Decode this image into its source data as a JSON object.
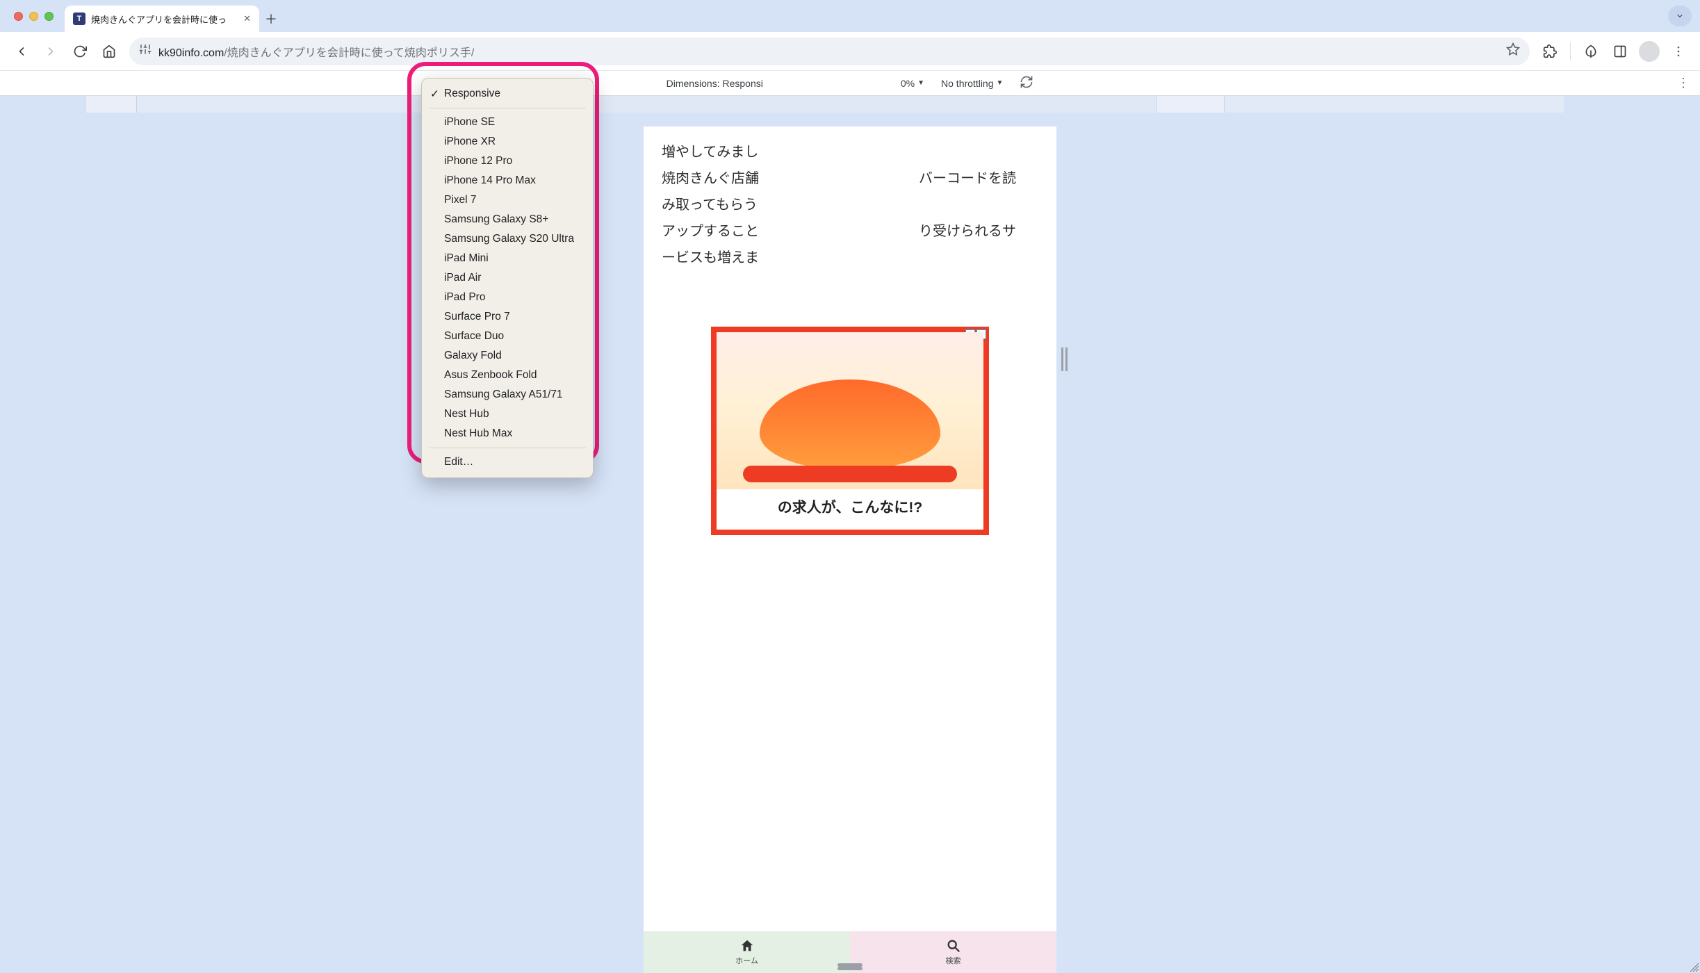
{
  "browser": {
    "tab_title": "焼肉きんぐアプリを会計時に使っ",
    "url_domain": "kk90info.com",
    "url_path": "/焼肉きんぐアプリを会計時に使って焼肉ポリス手/"
  },
  "device_bar": {
    "dimensions_label": "Dimensions: Responsi",
    "zoom_suffix": "0%",
    "throttling": "No throttling"
  },
  "device_menu": {
    "selected": "Responsive",
    "items": [
      "iPhone SE",
      "iPhone XR",
      "iPhone 12 Pro",
      "iPhone 14 Pro Max",
      "Pixel 7",
      "Samsung Galaxy S8+",
      "Samsung Galaxy S20 Ultra",
      "iPad Mini",
      "iPad Air",
      "iPad Pro",
      "Surface Pro 7",
      "Surface Duo",
      "Galaxy Fold",
      "Asus Zenbook Fold",
      "Samsung Galaxy A51/71",
      "Nest Hub",
      "Nest Hub Max"
    ],
    "edit": "Edit…"
  },
  "page_content": {
    "para0_fragment": "増やしてみまし",
    "para1_left": "焼肉きんぐ店舗",
    "para1_right": "バーコードを読",
    "para2": "み取ってもらう",
    "para3_left": "アップすること",
    "para3_right": "り受けられるサ",
    "para4": "ービスも増えま",
    "ad_line": "の求人が、こんなに!?"
  },
  "bottom_nav": {
    "home": "ホーム",
    "search": "検索"
  }
}
